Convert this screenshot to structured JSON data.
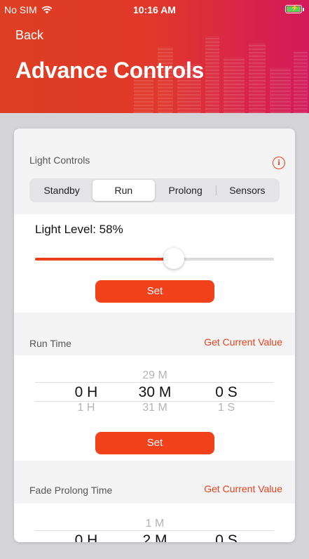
{
  "status_bar": {
    "carrier": "No SIM",
    "time": "10:16 AM",
    "battery_color": "#5bd35b"
  },
  "nav": {
    "back_label": "Back",
    "title": "Advance Controls"
  },
  "colors": {
    "accent": "#e8401c",
    "button": "#f2421c",
    "header_start": "#de3f22",
    "header_end": "#d21a5a"
  },
  "light_controls": {
    "label": "Light Controls",
    "info_icon": "info-circle-icon",
    "tabs": [
      {
        "label": "Standby",
        "active": false
      },
      {
        "label": "Run",
        "active": true
      },
      {
        "label": "Prolong",
        "active": false
      },
      {
        "label": "Sensors",
        "active": false
      }
    ],
    "light_level_text": "Light Level: 58%",
    "light_level_value": 0.58,
    "set_label": "Set"
  },
  "run_time": {
    "label": "Run Time",
    "get_current_label": "Get Current Value",
    "picker": {
      "above": [
        "",
        "29 M",
        ""
      ],
      "selected": [
        "0 H",
        "30 M",
        "0 S"
      ],
      "below": [
        "1 H",
        "31 M",
        "1 S"
      ]
    },
    "set_label": "Set"
  },
  "fade_prolong_time": {
    "label": "Fade Prolong Time",
    "get_current_label": "Get Current Value",
    "picker": {
      "above": [
        "",
        "1 M",
        ""
      ],
      "selected": [
        "0 H",
        "2 M",
        "0 S"
      ]
    }
  }
}
